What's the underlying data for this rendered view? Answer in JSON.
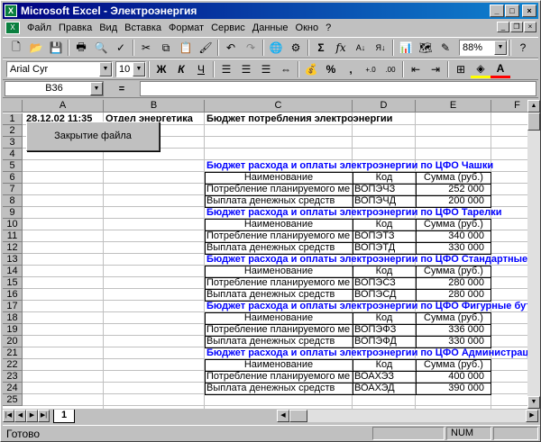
{
  "window": {
    "title": "Microsoft Excel - Электроэнергия",
    "app_icon": "excel-icon",
    "icon_letter": "X",
    "doc_icon_letter": "X"
  },
  "window_buttons": {
    "minimize": "_",
    "maximize": "□",
    "close": "×"
  },
  "doc_buttons": {
    "minimize": "_",
    "restore": "❐",
    "close": "×"
  },
  "menu": [
    "Файл",
    "Правка",
    "Вид",
    "Вставка",
    "Формат",
    "Сервис",
    "Данные",
    "Окно",
    "?"
  ],
  "toolbar_standard": {
    "zoom": "88%"
  },
  "toolbar_format": {
    "font": "Arial Cyr",
    "size": "10",
    "bold": "Ж",
    "italic": "К",
    "underline": "Ч",
    "percent": "%",
    "comma": ","
  },
  "formula_bar": {
    "cell_ref": "B36",
    "equals": "=",
    "value": ""
  },
  "columns": [
    "A",
    "B",
    "C",
    "D",
    "E",
    "F"
  ],
  "rows": [
    "1",
    "2",
    "3",
    "4",
    "5",
    "6",
    "7",
    "8",
    "9",
    "10",
    "11",
    "12",
    "13",
    "14",
    "15",
    "16",
    "17",
    "18",
    "19",
    "20",
    "21",
    "22",
    "23",
    "24",
    "25"
  ],
  "header_cells": {
    "date": "28.12.02 11:35",
    "dept": "Отдел энергетика",
    "budget_title": "Бюджет потребления электроэнергии"
  },
  "button": {
    "label": "Закрытие файла"
  },
  "sections": [
    {
      "title": "Бюджет расхода и оплаты электроэнергии по ЦФО Чашки",
      "rows": [
        {
          "name": "Потребление планируемого ме",
          "code": "ВОПЭЧЗ",
          "sum": "252 000"
        },
        {
          "name": "Выплата денежных средств",
          "code": "ВОПЭЧД",
          "sum": "200 000"
        }
      ]
    },
    {
      "title": "Бюджет расхода и оплаты электроэнергии по ЦФО Тарелки",
      "rows": [
        {
          "name": "Потребление планируемого ме",
          "code": "ВОПЭТЗ",
          "sum": "340 000"
        },
        {
          "name": "Выплата денежных средств",
          "code": "ВОПЭТД",
          "sum": "330 000"
        }
      ]
    },
    {
      "title": "Бюджет расхода и оплаты электроэнергии по ЦФО Стандартные",
      "rows": [
        {
          "name": "Потребление планируемого ме",
          "code": "ВОПЭСЗ",
          "sum": "280 000"
        },
        {
          "name": "Выплата денежных средств",
          "code": "ВОПЭСД",
          "sum": "280 000"
        }
      ]
    },
    {
      "title": "Бюджет расхода и оплаты электроэнергии по ЦФО Фигурные бут",
      "rows": [
        {
          "name": "Потребление планируемого ме",
          "code": "ВОПЭФЗ",
          "sum": "336 000"
        },
        {
          "name": "Выплата денежных средств",
          "code": "ВОПЭФД",
          "sum": "330 000"
        }
      ]
    },
    {
      "title": "Бюджет расхода и оплаты электроэнергии по ЦФО Администрац",
      "rows": [
        {
          "name": "Потребление планируемого ме",
          "code": "ВОАХЭЗ",
          "sum": "400 000"
        },
        {
          "name": "Выплата денежных средств",
          "code": "ВОАХЭД",
          "sum": "390 000"
        }
      ]
    }
  ],
  "table_headers": {
    "name": "Наименование",
    "code": "Код",
    "sum": "Сумма (руб.)"
  },
  "sheet_tab": "1",
  "status": {
    "text": "Готово",
    "num": "NUM"
  }
}
